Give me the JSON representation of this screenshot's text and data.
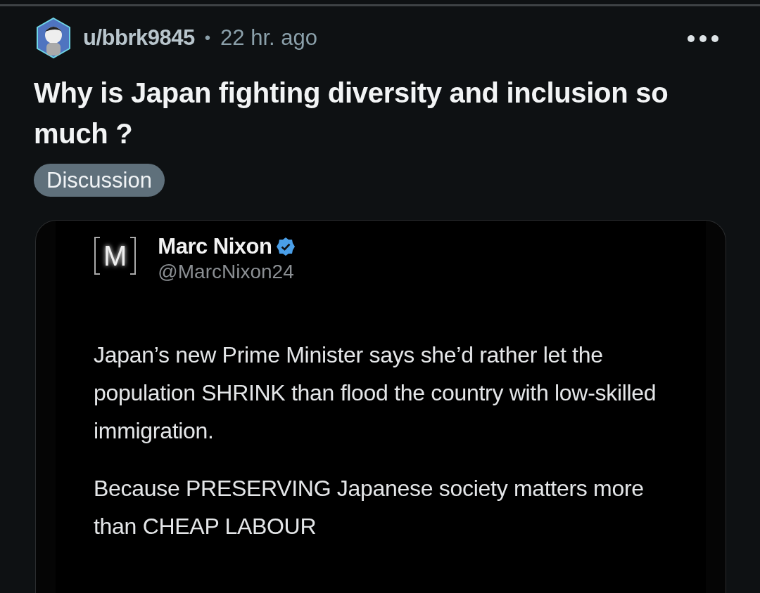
{
  "post": {
    "author": "u/bbrk9845",
    "separator": "•",
    "time": "22 hr. ago",
    "title": "Why is Japan fighting diversity and inclusion so much ?",
    "flair": "Discussion"
  },
  "embed": {
    "logo_letter": "M",
    "name": "Marc Nixon",
    "verified": true,
    "handle": "@MarcNixon24",
    "paragraphs": [
      "Japan’s new Prime Minister says she’d rather let the population SHRINK than flood the country with low-skilled immigration.",
      "Because PRESERVING Japanese society matters more than CHEAP LABOUR"
    ]
  }
}
